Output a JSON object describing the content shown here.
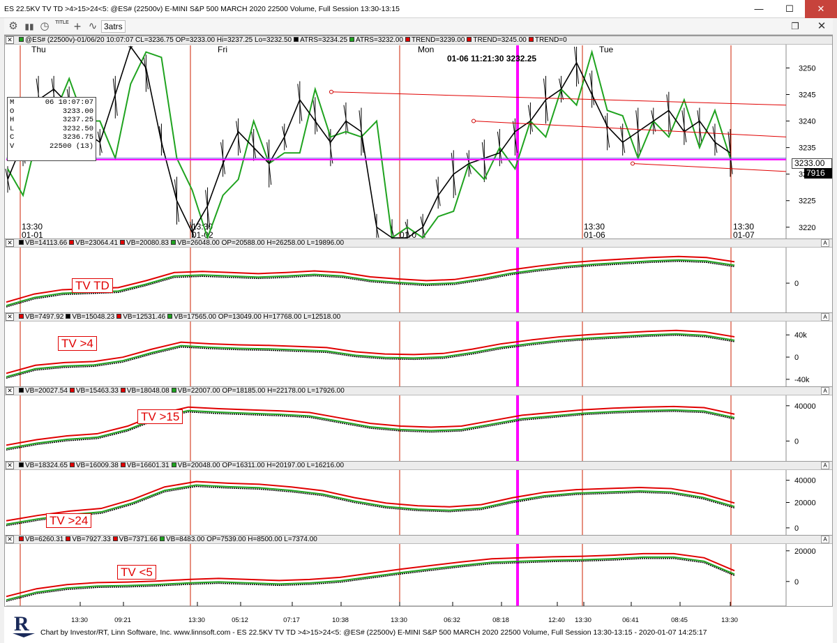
{
  "window": {
    "title": "ES 22.5KV TV TD >4>15>24<5: @ES# (22500v) E-MINI S&P 500 MARCH 2020 22500 Volume, Full Session 13:30-13:15",
    "minimize": "—",
    "maximize": "☐",
    "close": "✕"
  },
  "toolbar": {
    "gear_icon": "gear-icon",
    "title_button": "TITLE",
    "atrs_label": "3atrs",
    "restore": "❐",
    "close": "✕"
  },
  "price_pane": {
    "header": [
      {
        "color": "#1fa31f",
        "text": "@ES# (22500v)-01/06/20 10:07:07 CL=3236.75 OP=3233.00 Hi=3237.25 Lo=3232.50"
      },
      {
        "color": "#000000",
        "text": "ATRS=3234.25"
      },
      {
        "color": "#1fa31f",
        "text": "ATRS=3232.00"
      },
      {
        "color": "#e00000",
        "text": "TREND=3239.00"
      },
      {
        "color": "#e00000",
        "text": "TREND=3245.00"
      },
      {
        "color": "#e00000",
        "text": "TREND=0"
      }
    ],
    "days": [
      "Thu",
      "Fri",
      "Mon",
      "Tue"
    ],
    "y_ticks": [
      "3250",
      "3245",
      "3240",
      "3235",
      "3230",
      "3225",
      "3220"
    ],
    "x_labels": [
      {
        "time": "13:30",
        "date": "01-01"
      },
      {
        "time": "13:30",
        "date": "01-02"
      },
      {
        "time": "",
        "date": "01-0"
      },
      {
        "time": "13:30",
        "date": "01-06"
      },
      {
        "time": "13:30",
        "date": "01-07"
      }
    ],
    "cursor_readout": "01-06 11:21:30  3232.25",
    "last_price": "3233.00",
    "last_tag": "7916",
    "ohlc": {
      "M": "06 10:07:07",
      "O": "3233.00",
      "H": "3237.25",
      "L": "3232.50",
      "C": "3236.75",
      "V": "22500 (13)"
    },
    "price_range": [
      3218,
      3254
    ]
  },
  "indicators": [
    {
      "label": "TV TD",
      "header": [
        {
          "color": "#000000",
          "text": "VB=14113.66"
        },
        {
          "color": "#e00000",
          "text": "VB=23064.41"
        },
        {
          "color": "#e00000",
          "text": "VB=20080.83"
        },
        {
          "color": "#1fa31f",
          "text": "VB=26048.00 OP=20588.00 H=26258.00 L=19896.00"
        }
      ],
      "y_ticks": [
        "0"
      ]
    },
    {
      "label": "TV >4",
      "header": [
        {
          "color": "#e00000",
          "text": "VB=7497.92"
        },
        {
          "color": "#000000",
          "text": "VB=15048.23"
        },
        {
          "color": "#e00000",
          "text": "VB=12531.46"
        },
        {
          "color": "#1fa31f",
          "text": "VB=17565.00 OP=13049.00 H=17768.00 L=12518.00"
        }
      ],
      "y_ticks": [
        "40k",
        "0",
        "-40k"
      ]
    },
    {
      "label": "TV >15",
      "header": [
        {
          "color": "#000000",
          "text": "VB=20027.54"
        },
        {
          "color": "#e00000",
          "text": "VB=15463.33"
        },
        {
          "color": "#e00000",
          "text": "VB=18048.08"
        },
        {
          "color": "#1fa31f",
          "text": "VB=22007.00 OP=18185.00 H=22178.00 L=17926.00"
        }
      ],
      "y_ticks": [
        "40000",
        "0"
      ]
    },
    {
      "label": "TV >24",
      "header": [
        {
          "color": "#000000",
          "text": "VB=18324.65"
        },
        {
          "color": "#e00000",
          "text": "VB=16009.38"
        },
        {
          "color": "#e00000",
          "text": "VB=16601.31"
        },
        {
          "color": "#1fa31f",
          "text": "VB=20048.00 OP=16311.00 H=20197.00 L=16216.00"
        }
      ],
      "y_ticks": [
        "40000",
        "20000",
        "0"
      ]
    },
    {
      "label": "TV <5",
      "header": [
        {
          "color": "#e00000",
          "text": "VB=6260.31"
        },
        {
          "color": "#e00000",
          "text": "VB=7927.33"
        },
        {
          "color": "#e00000",
          "text": "VB=7371.66"
        },
        {
          "color": "#1fa31f",
          "text": "VB=8483.00 OP=7539.00 H=8500.00 L=7374.00"
        }
      ],
      "y_ticks": [
        "20000",
        "0"
      ]
    }
  ],
  "bottom_axis": [
    "13:30",
    "09:21",
    "13:30",
    "05:12",
    "07:17",
    "10:38",
    "13:30",
    "06:32",
    "08:18",
    "12:40",
    "13:30",
    "06:41",
    "08:45",
    "13:30"
  ],
  "footer": {
    "text": "Chart by Investor/RT, Linn Software, Inc. www.linnsoft.com - ES 22.5KV TV TD >4>15>24<5: @ES# (22500v) E-MINI S&P 500 MARCH 2020 22500 Volume, Full Session 13:30-13:15 - 2020-01-07 14:25:17"
  },
  "colors": {
    "cursor_line": "#ff00ff",
    "session_line": "#cc2200",
    "up_line": "#1fa31f",
    "trend_line": "#e00000",
    "price_line": "#000000"
  },
  "chart_data": [
    {
      "type": "line",
      "title": "",
      "xlabel": "",
      "ylabel": "",
      "ylim": [
        3218,
        3254
      ],
      "series": [
        {
          "name": "",
          "values": [
            3229,
            3236,
            3244,
            3246,
            3243,
            3238,
            3236,
            3245,
            3256,
            3250,
            3236,
            3225,
            3219,
            3224,
            3232,
            3238,
            3235,
            3232,
            3237,
            3244,
            3240,
            3236,
            3240,
            3238,
            3220,
            3218,
            3217,
            3220,
            3226,
            3230,
            3232,
            3233,
            3234,
            3238,
            3240,
            3244,
            3246,
            3251,
            3245,
            3239,
            3236,
            3238,
            3240,
            3242,
            3238,
            3240,
            3236,
            3234
          ]
        }
      ]
    },
    {
      "type": "line",
      "title": "",
      "series": [
        {
          "name": "",
          "values": [
            0.05,
            0.2,
            0.28,
            0.3,
            0.32,
            0.45,
            0.6,
            0.62,
            0.6,
            0.58,
            0.6,
            0.63,
            0.6,
            0.52,
            0.48,
            0.45,
            0.47,
            0.55,
            0.65,
            0.72,
            0.78,
            0.82,
            0.85,
            0.88,
            0.9,
            0.88,
            0.8
          ]
        }
      ]
    },
    {
      "type": "line",
      "title": "",
      "series": [
        {
          "name": "",
          "values": [
            0.1,
            0.25,
            0.3,
            0.32,
            0.4,
            0.55,
            0.68,
            0.65,
            0.63,
            0.62,
            0.6,
            0.58,
            0.5,
            0.46,
            0.45,
            0.47,
            0.55,
            0.65,
            0.72,
            0.78,
            0.82,
            0.85,
            0.88,
            0.9,
            0.87,
            0.78
          ]
        }
      ]
    },
    {
      "type": "line",
      "title": "",
      "series": [
        {
          "name": "",
          "values": [
            0.15,
            0.25,
            0.32,
            0.36,
            0.5,
            0.72,
            0.85,
            0.82,
            0.8,
            0.78,
            0.75,
            0.65,
            0.55,
            0.5,
            0.48,
            0.5,
            0.6,
            0.7,
            0.75,
            0.8,
            0.83,
            0.85,
            0.86,
            0.84,
            0.72
          ]
        }
      ]
    },
    {
      "type": "line",
      "title": "",
      "series": [
        {
          "name": "",
          "values": [
            0.12,
            0.22,
            0.3,
            0.35,
            0.52,
            0.75,
            0.85,
            0.82,
            0.8,
            0.75,
            0.68,
            0.55,
            0.45,
            0.4,
            0.38,
            0.42,
            0.55,
            0.65,
            0.7,
            0.72,
            0.74,
            0.72,
            0.62,
            0.45
          ]
        }
      ]
    },
    {
      "type": "line",
      "title": "",
      "series": [
        {
          "name": "",
          "values": [
            0.05,
            0.2,
            0.28,
            0.32,
            0.33,
            0.35,
            0.38,
            0.4,
            0.38,
            0.36,
            0.38,
            0.42,
            0.5,
            0.58,
            0.65,
            0.72,
            0.78,
            0.8,
            0.82,
            0.83,
            0.85,
            0.88,
            0.88,
            0.8,
            0.55
          ]
        }
      ]
    }
  ]
}
